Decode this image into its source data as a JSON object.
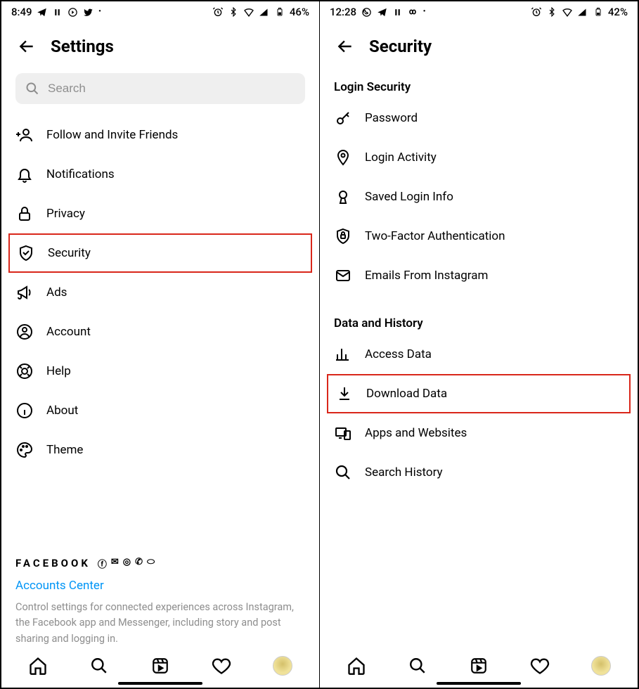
{
  "left": {
    "status": {
      "time": "8:49",
      "battery": "46%"
    },
    "title": "Settings",
    "search_placeholder": "Search",
    "items": [
      {
        "id": "invite",
        "label": "Follow and Invite Friends"
      },
      {
        "id": "notifications",
        "label": "Notifications"
      },
      {
        "id": "privacy",
        "label": "Privacy"
      },
      {
        "id": "security",
        "label": "Security",
        "highlight": true
      },
      {
        "id": "ads",
        "label": "Ads"
      },
      {
        "id": "account",
        "label": "Account"
      },
      {
        "id": "help",
        "label": "Help"
      },
      {
        "id": "about",
        "label": "About"
      },
      {
        "id": "theme",
        "label": "Theme"
      }
    ],
    "facebook_label": "FACEBOOK",
    "accounts_center": "Accounts Center",
    "accounts_desc": "Control settings for connected experiences across Instagram, the Facebook app and Messenger, including story and post sharing and logging in."
  },
  "right": {
    "status": {
      "time": "12:28",
      "battery": "42%"
    },
    "title": "Security",
    "sections": [
      {
        "header": "Login Security",
        "items": [
          {
            "id": "password",
            "label": "Password"
          },
          {
            "id": "login-activity",
            "label": "Login Activity"
          },
          {
            "id": "saved-login",
            "label": "Saved Login Info"
          },
          {
            "id": "two-factor",
            "label": "Two-Factor Authentication"
          },
          {
            "id": "emails",
            "label": "Emails From Instagram"
          }
        ]
      },
      {
        "header": "Data and History",
        "items": [
          {
            "id": "access-data",
            "label": "Access Data"
          },
          {
            "id": "download-data",
            "label": "Download Data",
            "highlight": true
          },
          {
            "id": "apps-websites",
            "label": "Apps and Websites"
          },
          {
            "id": "search-history",
            "label": "Search History"
          }
        ]
      }
    ]
  }
}
